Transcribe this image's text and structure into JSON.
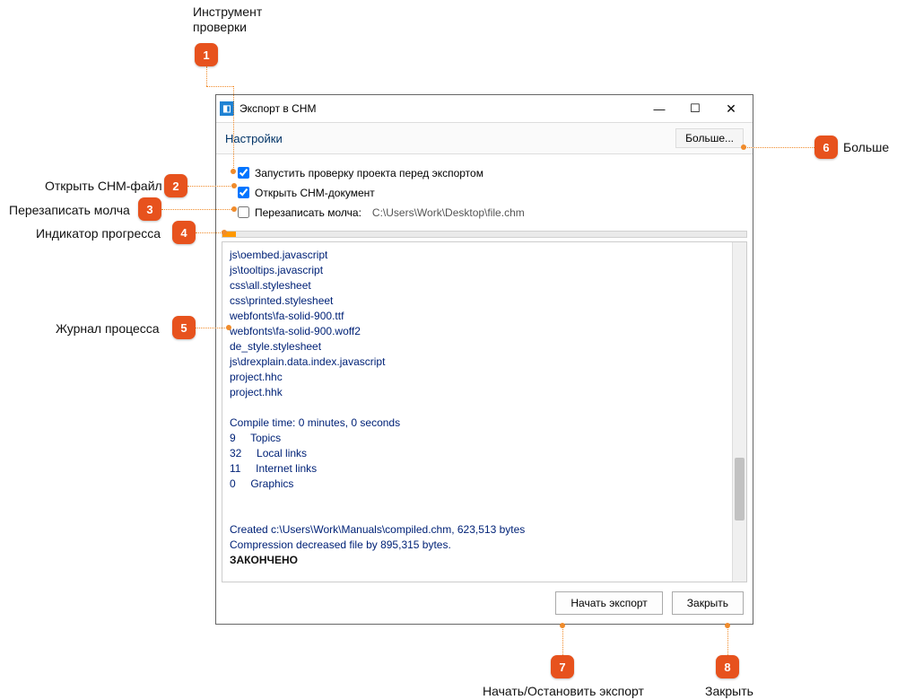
{
  "dialog": {
    "title": "Экспорт в CHM",
    "settings_label": "Настройки",
    "more_label": "Больше...",
    "chk1_label": "Запустить проверку проекта перед экспортом",
    "chk2_label": "Открыть CHM-документ",
    "chk3_label": "Перезаписать молча:",
    "chk3_path": "C:\\Users\\Work\\Desktop\\file.chm",
    "btn_start": "Начать экспорт",
    "btn_close": "Закрыть"
  },
  "log": {
    "lines": [
      "js\\oembed.javascript",
      "js\\tooltips.javascript",
      "css\\all.stylesheet",
      "css\\printed.stylesheet",
      "webfonts\\fa-solid-900.ttf",
      "webfonts\\fa-solid-900.woff2",
      "de_style.stylesheet",
      "js\\drexplain.data.index.javascript",
      "project.hhc",
      "project.hhk",
      "",
      "Compile time: 0 minutes, 0 seconds",
      "9     Topics",
      "32     Local links",
      "11     Internet links",
      "0     Graphics",
      "",
      "",
      "Created c:\\Users\\Work\\Manuals\\compiled.chm, 623,513 bytes",
      "Compression decreased file by 895,315 bytes."
    ],
    "done_label": "ЗАКОНЧЕНО"
  },
  "callouts": {
    "c1_num": "1",
    "c1_label1": "Инструмент",
    "c1_label2": "проверки",
    "c2_num": "2",
    "c2_label": "Открыть CHM-файл",
    "c3_num": "3",
    "c3_label": "Перезаписать молча",
    "c4_num": "4",
    "c4_label": "Индикатор прогресса",
    "c5_num": "5",
    "c5_label": "Журнал процесса",
    "c6_num": "6",
    "c6_label": "Больше",
    "c7_num": "7",
    "c7_label": "Начать/Остановить экспорт",
    "c8_num": "8",
    "c8_label": "Закрыть"
  }
}
